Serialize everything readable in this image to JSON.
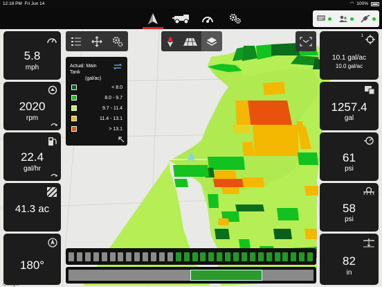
{
  "status": {
    "time": "12:18 PM",
    "date": "Fri Jun 14",
    "battery": "100%"
  },
  "nav": {
    "tabs": [
      {
        "icon": "guidance-arrow-icon",
        "active": true
      },
      {
        "icon": "tractor-implement-icon",
        "active": false
      },
      {
        "icon": "gauge-icon",
        "active": false
      },
      {
        "icon": "gears-icon",
        "active": false
      }
    ]
  },
  "left_tiles": [
    {
      "icon": "speedometer-icon",
      "value": "5.8",
      "unit": "mph"
    },
    {
      "icon": "engine-rpm-icon",
      "value": "2020",
      "unit": "rpm"
    },
    {
      "icon": "fuel-pump-icon",
      "value": "22.4",
      "unit": "gal/hr"
    },
    {
      "icon": "area-hatch-icon",
      "value": "41.3 ac",
      "unit": ""
    },
    {
      "icon": "compass-icon",
      "value": "180°",
      "unit": ""
    }
  ],
  "right_tiles": [
    {
      "icon": "target-rate-icon",
      "value": "10.1 gal/ac",
      "unit": "10.0 gal/ac"
    },
    {
      "icon": "tank-volume-icon",
      "value": "1257.4",
      "unit": "gal"
    },
    {
      "icon": "pump-pressure-icon",
      "value": "61",
      "unit": "psi"
    },
    {
      "icon": "boom-pressure-icon",
      "value": "58",
      "unit": "psi"
    },
    {
      "icon": "boom-height-icon",
      "value": "82",
      "unit": "in"
    }
  ],
  "legend": {
    "title_line1": "Actual: Main",
    "title_line2": "Tank",
    "units": "(gal/ac)",
    "ranges": [
      {
        "label": "< 8.0",
        "color": "#0a5f1a"
      },
      {
        "label": "8.0 - 9.7",
        "color": "#12c21e"
      },
      {
        "label": "9.7 - 11.4",
        "color": "#b8f25a"
      },
      {
        "label": "11.4 - 13.1",
        "color": "#f5b800"
      },
      {
        "label": "> 13.1",
        "color": "#e8520c"
      }
    ]
  },
  "map_toolbar": {
    "left": [
      "list-icon",
      "pan-icon",
      "settings-gear-icon"
    ],
    "center": [
      "north-arrow-icon",
      "perspective-grid-icon",
      "layers-icon"
    ],
    "right": [
      "zoom-extents-icon"
    ]
  },
  "sections": {
    "count": 30,
    "active_from": 13,
    "active_to": 30
  },
  "progress": {
    "fraction": 0.8
  },
  "attribution": "Google"
}
